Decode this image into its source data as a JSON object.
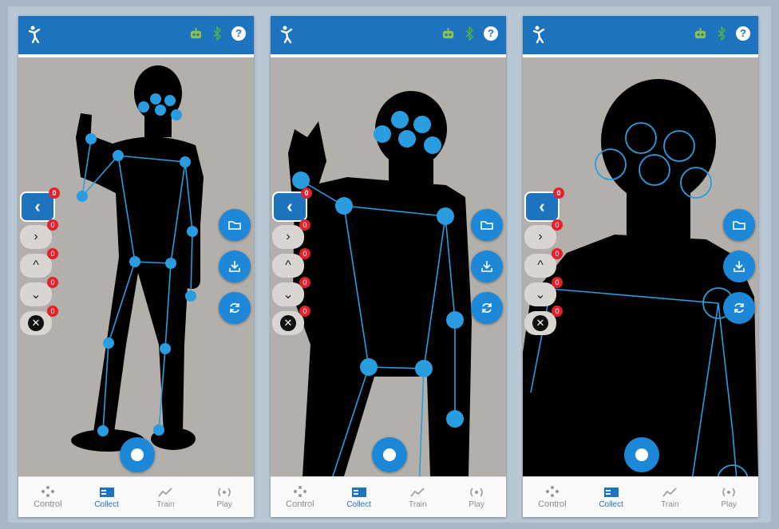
{
  "colors": {
    "app_bar": "#1e73be",
    "accent": "#1e88d8",
    "badge": "#e2212b",
    "robot_status": "#8bc34a"
  },
  "icons": {
    "app": "person-pose-icon",
    "robot": "robot-icon",
    "bluetooth": "bluetooth-icon",
    "help": "help-icon"
  },
  "side_controls": [
    {
      "icon": "chevron-left-icon",
      "glyph": "‹",
      "count": "0"
    },
    {
      "icon": "chevron-right-icon",
      "glyph": "›",
      "count": "0"
    },
    {
      "icon": "chevron-up-icon",
      "glyph": "^",
      "count": "0"
    },
    {
      "icon": "chevron-down-icon",
      "glyph": "⌄",
      "count": "0"
    },
    {
      "icon": "close-icon",
      "glyph": "✕",
      "count": "0"
    }
  ],
  "help_glyph": "?",
  "nav": [
    {
      "label": "Control",
      "icon": "gamepad-icon"
    },
    {
      "label": "Collect",
      "icon": "collect-icon"
    },
    {
      "label": "Train",
      "icon": "train-icon"
    },
    {
      "label": "Play",
      "icon": "broadcast-icon"
    }
  ]
}
